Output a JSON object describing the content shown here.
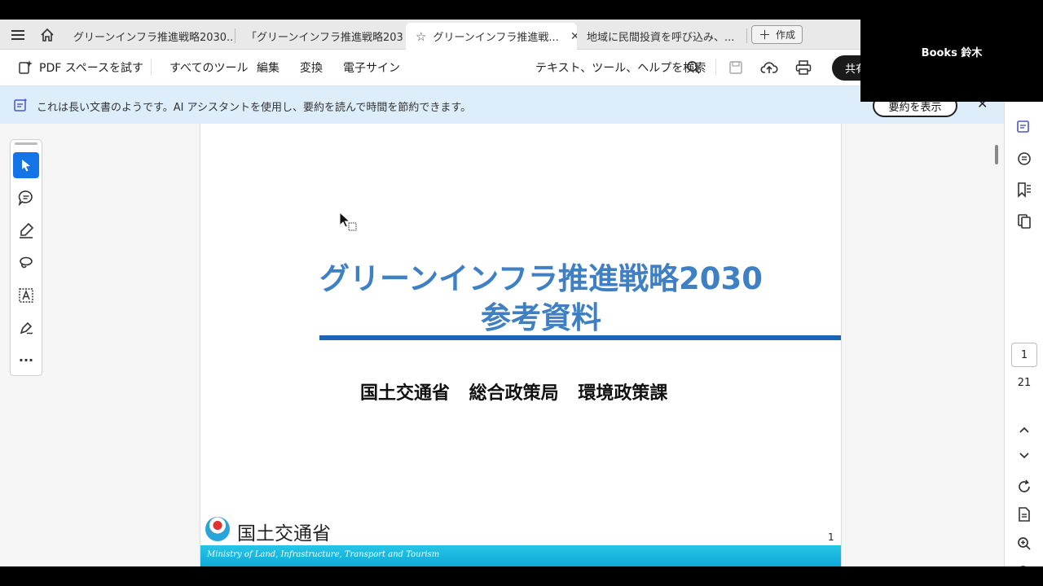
{
  "tabs": [
    {
      "label": "グリーンインフラ推進戦略2030..."
    },
    {
      "label": "「グリーンインフラ推進戦略203..."
    },
    {
      "label": "グリーンインフラ推進戦...",
      "active": true
    },
    {
      "label": "地域に民間投資を呼び込み、..."
    }
  ],
  "new_tab_label": "作成",
  "toolbar": {
    "pdf_space": "PDF スペースを試す",
    "all_tools": "すべてのツール",
    "edit": "編集",
    "convert": "変換",
    "esign": "電子サイン",
    "search": "テキスト、ツール、ヘルプを検索",
    "share": "共有"
  },
  "banner": {
    "text": "これは長い文書のようです。AI アシスタントを使用し、要約を読んで時間を節約できます。",
    "summary_button": "要約を表示",
    "close": "✕"
  },
  "document": {
    "title_line1": "グリーンインフラ推進戦略2030",
    "title_line2": "参考資料",
    "ministry_line": "国土交通省 総合政策局 環境政策課",
    "logo_text": "国土交通省",
    "band_text": "Ministry of Land, Infrastructure, Transport and Tourism",
    "page_number": "1"
  },
  "pagination": {
    "current": "1",
    "total": "21"
  },
  "overlay": {
    "name": "Books 鈴木"
  },
  "colors": {
    "accent": "#1473e6",
    "title_blue": "#3f7fc4",
    "rule_blue": "#1d63b8",
    "band": "#1fb6e0"
  }
}
